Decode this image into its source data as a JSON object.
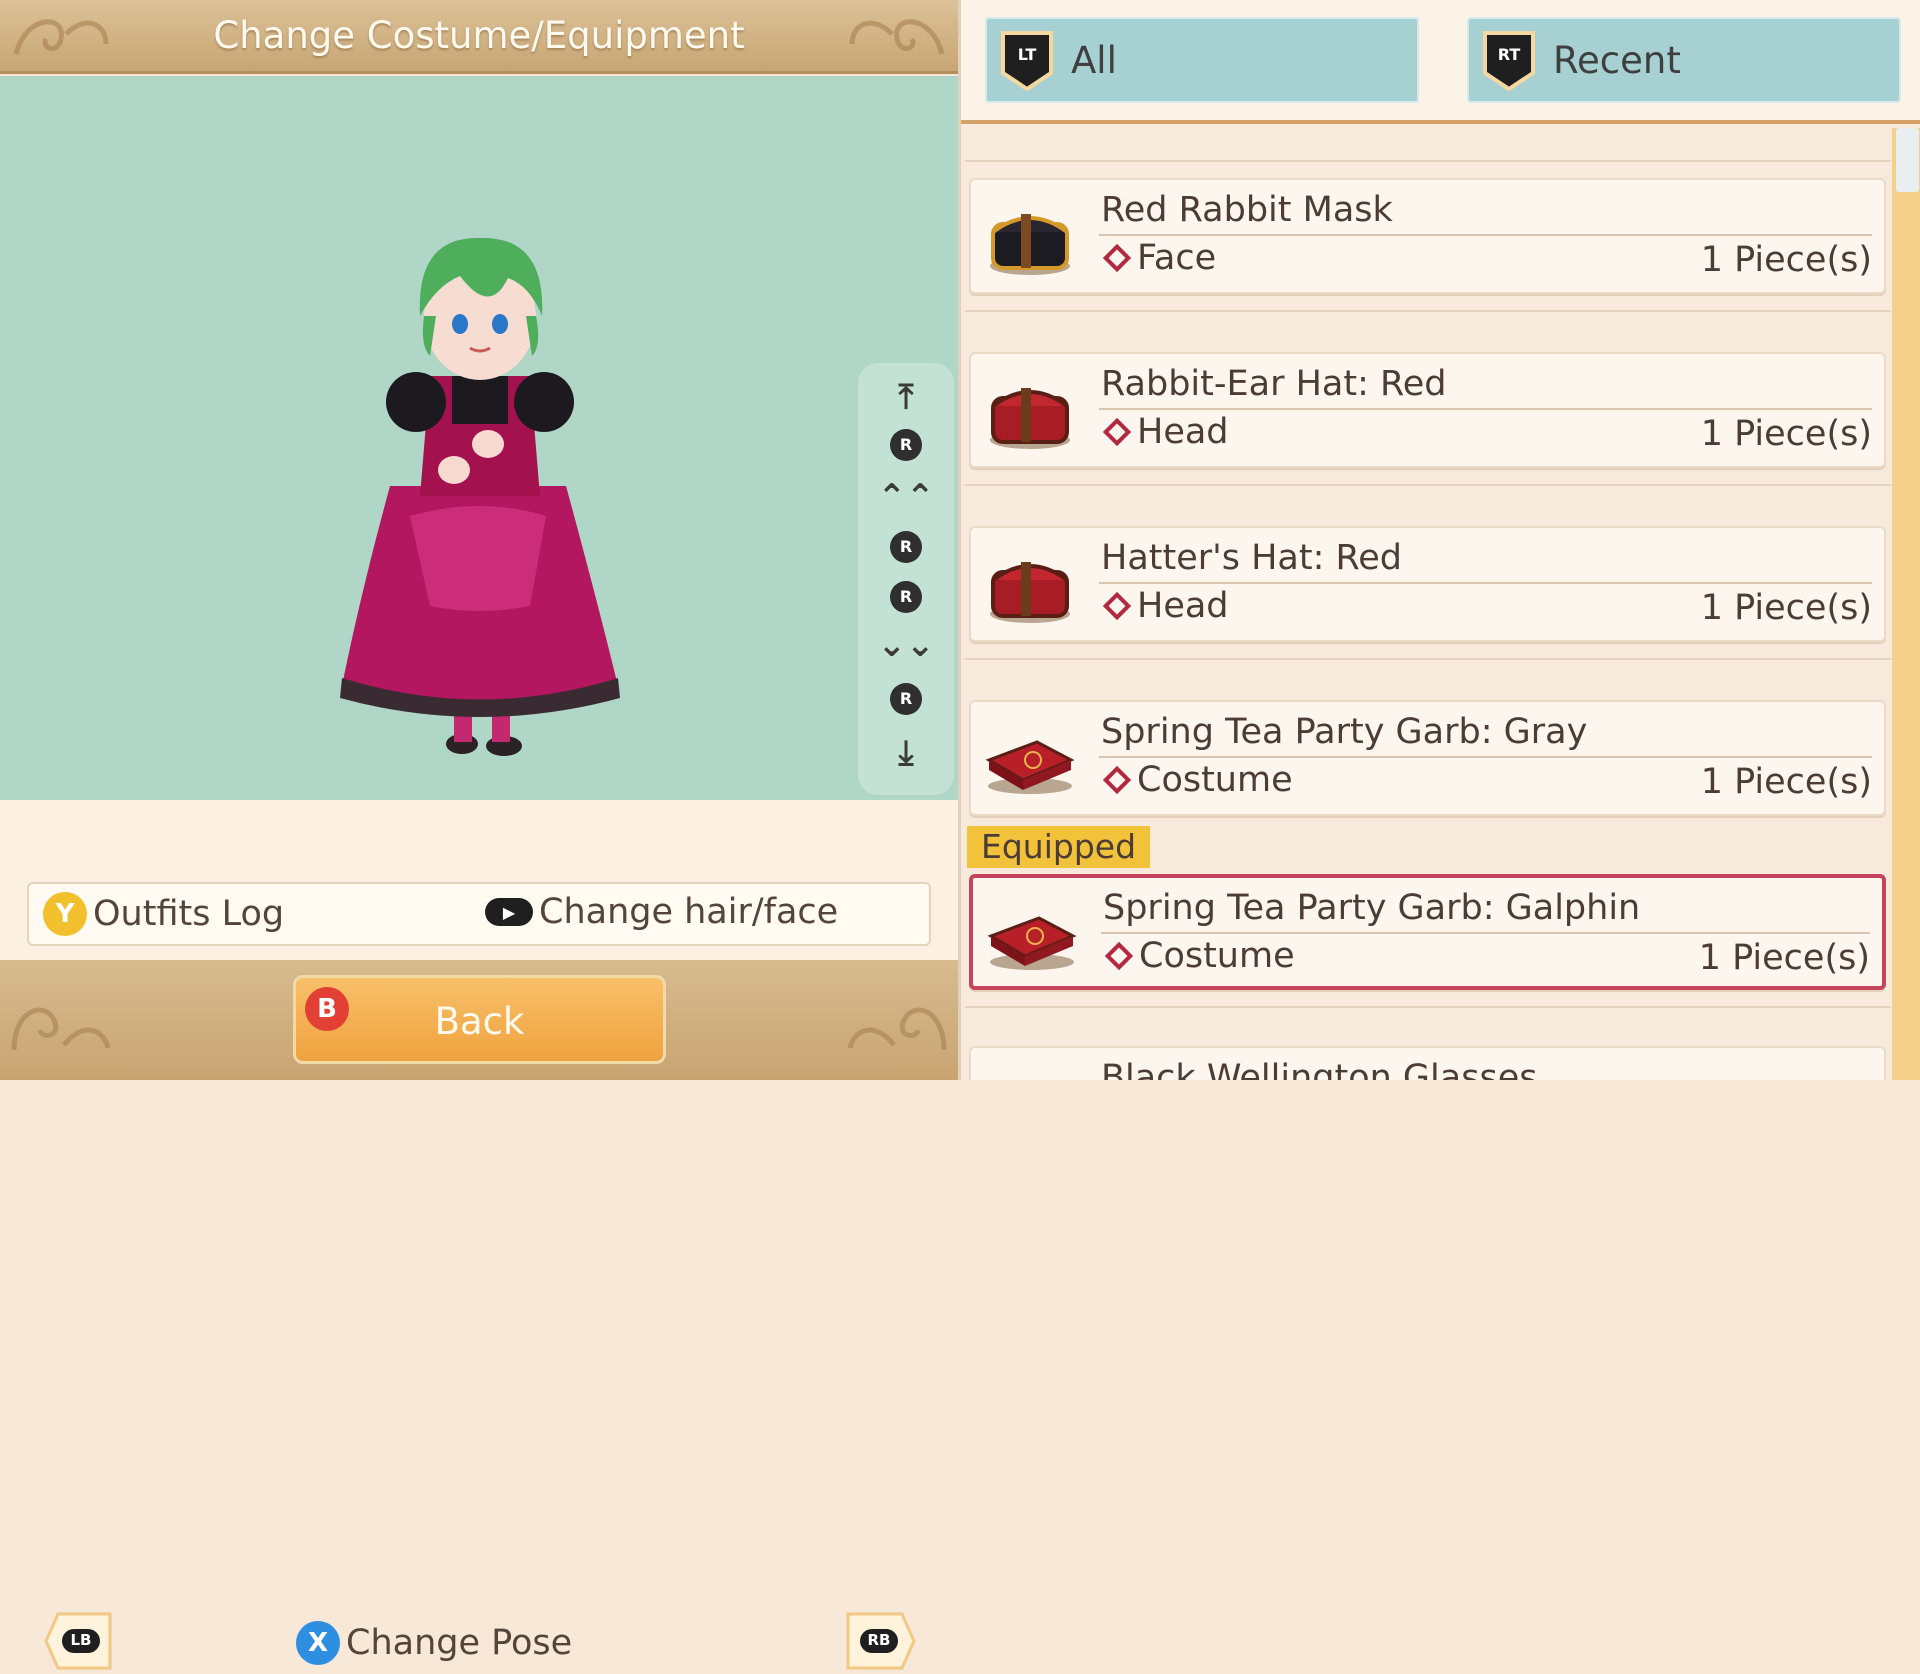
{
  "left": {
    "title": "Change Costume/Equipment",
    "shoulder_left": "LB",
    "shoulder_right": "RB",
    "pose": {
      "button": "X",
      "label": "Change Pose"
    },
    "outfits_log": {
      "button": "Y",
      "label": "Outfits Log"
    },
    "hair_face": {
      "label": "Change hair/face"
    },
    "back": {
      "button": "B",
      "label": "Back"
    },
    "camera_rail_labels": [
      "R",
      "R",
      "R",
      "R"
    ]
  },
  "tabs": [
    {
      "badge": "LT",
      "label": "All"
    },
    {
      "badge": "RT",
      "label": "Recent"
    }
  ],
  "items": [
    {
      "name": "Red Rabbit Mask",
      "category": "Face",
      "qty": "1 Piece(s)",
      "icon": "chest-icon"
    },
    {
      "name": "Rabbit-Ear Hat: Red",
      "category": "Head",
      "qty": "1 Piece(s)",
      "icon": "chest-icon"
    },
    {
      "name": "Hatter's Hat: Red",
      "category": "Head",
      "qty": "1 Piece(s)",
      "icon": "chest-icon"
    },
    {
      "name": "Spring Tea Party Garb: Gray",
      "category": "Costume",
      "qty": "1 Piece(s)",
      "icon": "flat-case-icon"
    },
    {
      "name": "Spring Tea Party Garb: Galphin",
      "category": "Costume",
      "qty": "1 Piece(s)",
      "icon": "flat-case-icon"
    },
    {
      "name": "Black Wellington Glasses"
    }
  ],
  "equipped_label": "Equipped",
  "colors": {
    "accent_red": "#b3283e",
    "equipped_border": "#c4435d",
    "stage_bg": "#afd6c6",
    "tab_bg": "#a6d0d1",
    "back_button": "#efa23e",
    "x_button": "#2e8fe0",
    "y_button": "#f1c02c",
    "b_button": "#e24035"
  }
}
